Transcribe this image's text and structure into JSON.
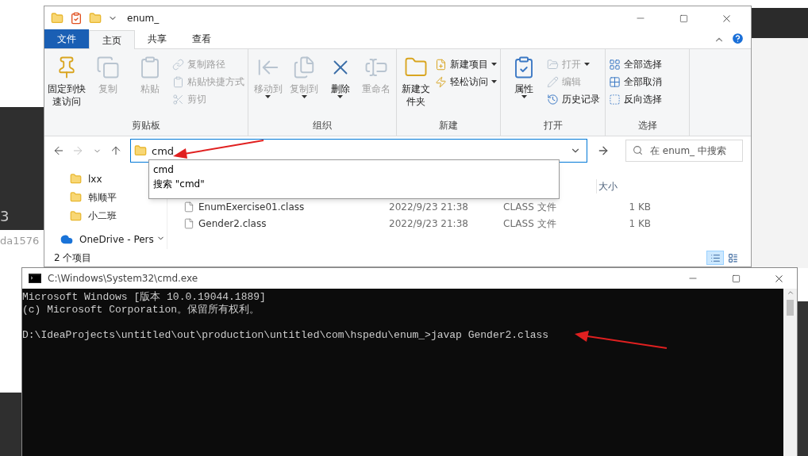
{
  "background": {
    "texts": [
      "3",
      "da1576"
    ]
  },
  "explorer": {
    "title": "enum_",
    "ribbon_tabs": [
      {
        "label": "文件",
        "kind": "file",
        "selected": false
      },
      {
        "label": "主页",
        "kind": "tab",
        "selected": true
      },
      {
        "label": "共享",
        "kind": "tab",
        "selected": false
      },
      {
        "label": "查看",
        "kind": "tab",
        "selected": false
      }
    ],
    "ribbon_groups": [
      {
        "label": "剪贴板",
        "items": [
          {
            "label": "固定到快速访问",
            "kind": "large",
            "disabled": false,
            "dropdown": false
          },
          {
            "label": "复制",
            "kind": "large",
            "disabled": true,
            "dropdown": false
          },
          {
            "label": "粘贴",
            "kind": "large",
            "disabled": true,
            "dropdown": false
          },
          {
            "label": "复制路径",
            "kind": "small",
            "disabled": true,
            "dropdown": false
          },
          {
            "label": "粘贴快捷方式",
            "kind": "small",
            "disabled": true,
            "dropdown": false
          },
          {
            "label": "剪切",
            "kind": "small",
            "disabled": true,
            "dropdown": false
          }
        ]
      },
      {
        "label": "组织",
        "items": [
          {
            "label": "移动到",
            "kind": "large",
            "disabled": true,
            "dropdown": true
          },
          {
            "label": "复制到",
            "kind": "large",
            "disabled": true,
            "dropdown": true
          },
          {
            "label": "删除",
            "kind": "large",
            "disabled": false,
            "dropdown": true
          },
          {
            "label": "重命名",
            "kind": "large",
            "disabled": true,
            "dropdown": false
          }
        ]
      },
      {
        "label": "新建",
        "items": [
          {
            "label": "新建文件夹",
            "kind": "large",
            "disabled": false,
            "dropdown": false
          },
          {
            "label": "新建项目",
            "kind": "small",
            "disabled": false,
            "dropdown": true
          },
          {
            "label": "轻松访问",
            "kind": "small",
            "disabled": false,
            "dropdown": true
          }
        ]
      },
      {
        "label": "打开",
        "items": [
          {
            "label": "属性",
            "kind": "large",
            "disabled": false,
            "dropdown": true
          },
          {
            "label": "打开",
            "kind": "small",
            "disabled": true,
            "dropdown": true
          },
          {
            "label": "编辑",
            "kind": "small",
            "disabled": true,
            "dropdown": false
          },
          {
            "label": "历史记录",
            "kind": "small",
            "disabled": false,
            "dropdown": false
          }
        ]
      },
      {
        "label": "选择",
        "items": [
          {
            "label": "全部选择",
            "kind": "small",
            "disabled": false,
            "dropdown": false
          },
          {
            "label": "全部取消",
            "kind": "small",
            "disabled": false,
            "dropdown": false
          },
          {
            "label": "反向选择",
            "kind": "small",
            "disabled": false,
            "dropdown": false
          }
        ]
      }
    ],
    "nav_buttons": [
      {
        "kind": "back",
        "disabled": false
      },
      {
        "kind": "forward",
        "disabled": true
      },
      {
        "kind": "recent",
        "disabled": false
      },
      {
        "kind": "up",
        "disabled": false
      }
    ],
    "address": {
      "value": "cmd"
    },
    "search": {
      "placeholder": "在 enum_ 中搜索"
    },
    "suggestions": [
      "cmd",
      "搜索 \"cmd\""
    ],
    "nav_pane": [
      {
        "label": "lxx",
        "kind": "folder"
      },
      {
        "label": "韩顺平",
        "kind": "folder"
      },
      {
        "label": "小二班",
        "kind": "folder"
      },
      {
        "label": "OneDrive - Pers",
        "kind": "cloud"
      }
    ],
    "columns": [
      "大小"
    ],
    "files": [
      {
        "name": "EnumExercise01.class",
        "date": "2022/9/23 21:38",
        "type": "CLASS 文件",
        "size": "1 KB"
      },
      {
        "name": "Gender2.class",
        "date": "2022/9/23 21:38",
        "type": "CLASS 文件",
        "size": "1 KB"
      }
    ],
    "status": "2 个项目",
    "views": [
      {
        "kind": "details",
        "selected": true
      },
      {
        "kind": "large",
        "selected": false
      }
    ]
  },
  "cmd": {
    "title": "C:\\Windows\\System32\\cmd.exe",
    "output": [
      "Microsoft Windows [版本 10.0.19044.1889]",
      "(c) Microsoft Corporation。保留所有权利。"
    ],
    "command_line": "D:\\IdeaProjects\\untitled\\out\\production\\untitled\\com\\hspedu\\enum_>javap Gender2.class"
  }
}
